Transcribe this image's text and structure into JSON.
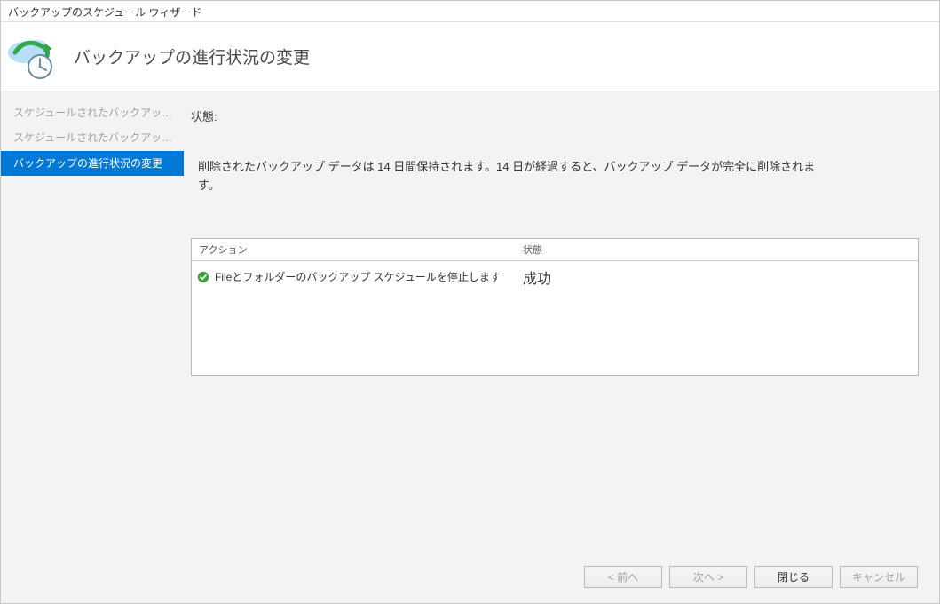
{
  "window_title": "バックアップのスケジュール ウィザード",
  "header": {
    "title": "バックアップの進行状況の変更"
  },
  "sidebar": {
    "items": [
      {
        "label": "スケジュールされたバックアップを.."
      },
      {
        "label": "スケジュールされたバックアップの停止"
      },
      {
        "label": "バックアップの進行状況の変更"
      }
    ],
    "active_index": 2
  },
  "content": {
    "status_label": "状態:",
    "description": "削除されたバックアップ データは 14 日間保持されます。14 日が経過すると、バックアップ データが完全に削除されます。"
  },
  "table": {
    "columns": {
      "action": "アクション",
      "status": "状態"
    },
    "rows": [
      {
        "action": "Fileとフォルダーのバックアップ スケジュールを停止します",
        "status": "成功"
      }
    ]
  },
  "footer": {
    "prev": "< 前へ",
    "next": "次へ >",
    "close": "閉じる",
    "cancel": "キャンセル"
  }
}
